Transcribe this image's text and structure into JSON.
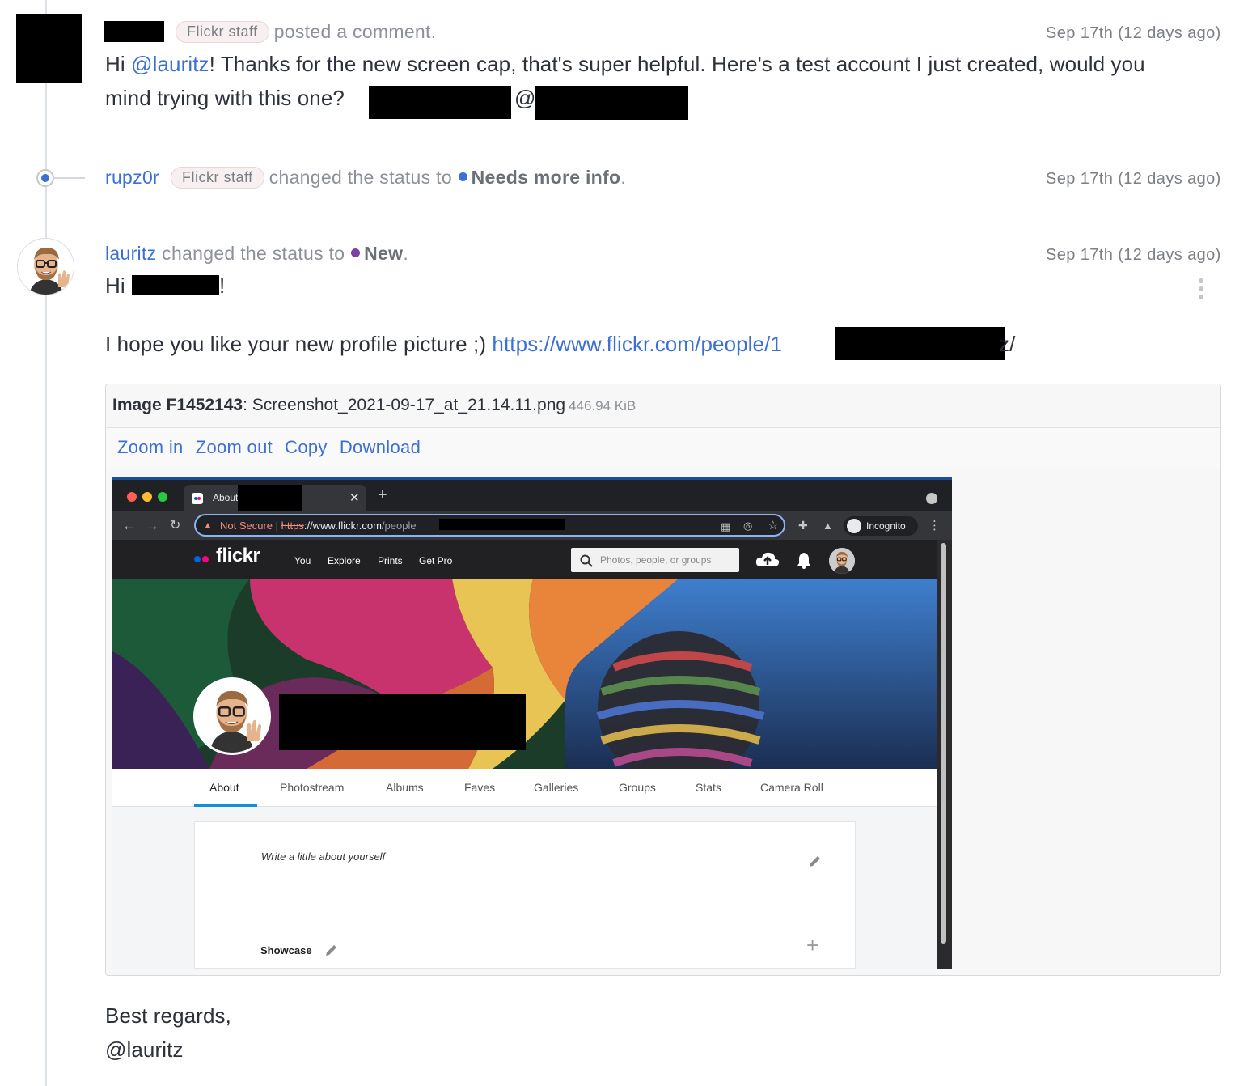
{
  "comment1": {
    "badge": "Flickr staff",
    "action": "posted a comment.",
    "time": "Sep 17th (12 days ago)",
    "line1_hi": "Hi ",
    "line1_mention": "@lauritz",
    "line1_rest": "! Thanks for the new screen cap, that's super helpful. Here's a test account I just created, would you",
    "line2": "mind trying with this one? ",
    "line2_at": "@"
  },
  "status1": {
    "user": "rupz0r",
    "badge": "Flickr staff",
    "action": "changed the status to",
    "status": "Needs more info",
    "status_color": "#3c6fd6",
    "period": ".",
    "time": "Sep 17th (12 days ago)"
  },
  "comment2": {
    "user": "lauritz",
    "action": "changed the status to",
    "status": "New",
    "status_color": "#7b3fa8",
    "period": ".",
    "time": "Sep 17th (12 days ago)",
    "greeting_hi": "Hi ",
    "greeting_end": "!",
    "line_text": "I hope you like your new profile picture ;) ",
    "link_start": "https://www.flickr.com/people/1",
    "link_end": "z/",
    "closing": "Best regards,",
    "signature": "@lauritz"
  },
  "file": {
    "label": "Image F1452143",
    "colon": ":",
    "filename": "Screenshot_2021-09-17_at_21.14.11.png",
    "size": "446.94 KiB",
    "actions": [
      "Zoom in",
      "Zoom out",
      "Copy",
      "Download"
    ]
  },
  "screenshot": {
    "tab_title": "About",
    "not_secure": "Not Secure",
    "url_proto": "https",
    "url_host": "://www.flickr.com",
    "url_path": "/people",
    "incognito": "Incognito",
    "logo": "flickr",
    "nav": [
      "You",
      "Explore",
      "Prints",
      "Get Pro"
    ],
    "search_placeholder": "Photos, people, or groups",
    "subnav": [
      "About",
      "Photostream",
      "Albums",
      "Faves",
      "Galleries",
      "Groups",
      "Stats",
      "Camera Roll"
    ],
    "about_placeholder": "Write a little about yourself",
    "showcase": "Showcase"
  }
}
